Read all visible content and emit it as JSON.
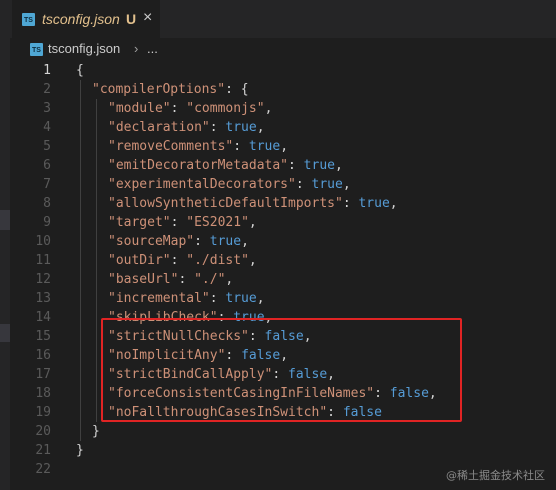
{
  "tab": {
    "file_name": "tsconfig.json",
    "modified_badge": "U",
    "close_glyph": "×",
    "badge_text": "TS"
  },
  "breadcrumb": {
    "file_name": "tsconfig.json",
    "separator": "›",
    "more": "..."
  },
  "editor": {
    "active_line": 1,
    "lines": [
      "{",
      "\"compilerOptions\": {",
      "\"module\": \"commonjs\",",
      "\"declaration\": true,",
      "\"removeComments\": true,",
      "\"emitDecoratorMetadata\": true,",
      "\"experimentalDecorators\": true,",
      "\"allowSyntheticDefaultImports\": true,",
      "\"target\": \"ES2021\",",
      "\"sourceMap\": true,",
      "\"outDir\": \"./dist\",",
      "\"baseUrl\": \"./\",",
      "\"incremental\": true,",
      "\"skipLibCheck\": true,",
      "\"strictNullChecks\": false,",
      "\"noImplicitAny\": false,",
      "\"strictBindCallApply\": false,",
      "\"forceConsistentCasingInFileNames\": false,",
      "\"noFallthroughCasesInSwitch\": false",
      "}",
      "}",
      ""
    ],
    "line_numbers": [
      "1",
      "2",
      "3",
      "4",
      "5",
      "6",
      "7",
      "8",
      "9",
      "10",
      "11",
      "12",
      "13",
      "14",
      "15",
      "16",
      "17",
      "18",
      "19",
      "20",
      "21",
      "22"
    ]
  },
  "highlight": {
    "from_line": 15,
    "to_line": 19,
    "color": "#e02424"
  },
  "watermark": "@稀土掘金技术社区",
  "colors": {
    "background": "#1e1e1e",
    "string_key": "#ce9178",
    "boolean": "#569cd6",
    "modified": "#e2c08d"
  }
}
